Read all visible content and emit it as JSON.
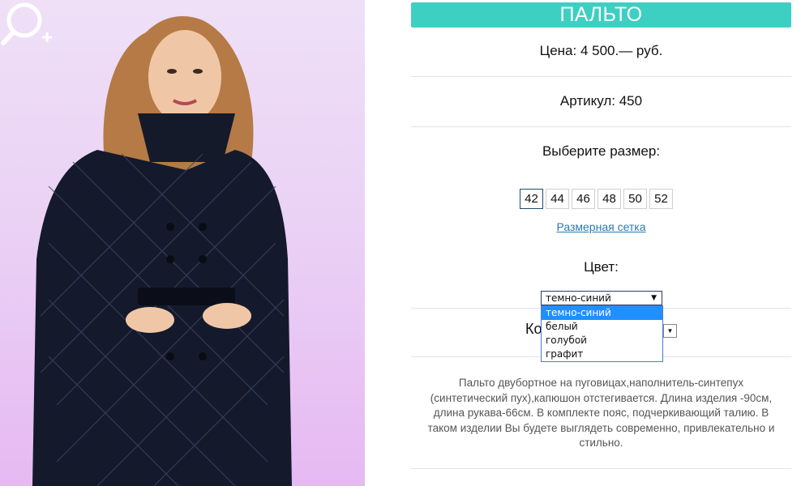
{
  "product": {
    "title": "ПАЛЬТО",
    "price": "Цена: 4 500.— руб.",
    "article": "Артикул: 450",
    "size_heading": "Выберите размер:",
    "sizes": [
      "42",
      "44",
      "46",
      "48",
      "50",
      "52"
    ],
    "selected_size": "42",
    "size_chart_link": "Размерная сетка",
    "color_heading": "Цвет:",
    "color_selected": "темно-синий",
    "color_options": [
      "темно-синий",
      "белый",
      "голубой",
      "графит"
    ],
    "quantity_label_partial": "Ко",
    "description": "Пальто двубортное на пуговицах,наполнитель-синтепух (синтетический пух),капюшон отстегивается. Длина изделия -90см, длина рукава-66см. В комплекте пояс, подчеркивающий талию. В таком изделии Вы будете выглядеть современно, привлекательно и стильно."
  },
  "colors": {
    "accent": "#3ecfc3",
    "link": "#2a7ab0",
    "option_highlight": "#1e90ff"
  },
  "icons": {
    "zoom": "zoom-in-icon",
    "dropdown_arrow": "▼"
  }
}
